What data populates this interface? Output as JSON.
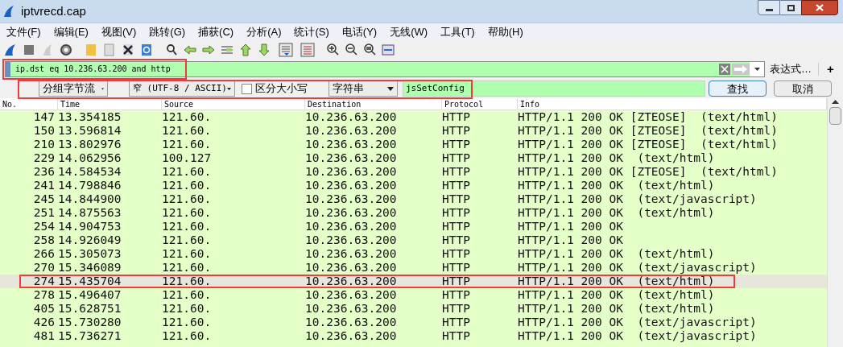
{
  "window": {
    "title": "iptvrecd.cap"
  },
  "menu": [
    "文件(F)",
    "编辑(E)",
    "视图(V)",
    "跳转(G)",
    "捕获(C)",
    "分析(A)",
    "统计(S)",
    "电话(Y)",
    "无线(W)",
    "工具(T)",
    "帮助(H)"
  ],
  "filter": {
    "value": "ip.dst eq 10.236.63.200 and http",
    "expression_label": "表达式…",
    "add_label": "+"
  },
  "find_bar": {
    "search_in": "分组字节流",
    "charset": "窄 (UTF-8 / ASCII)",
    "case_sensitive": {
      "label": "区分大小写",
      "checked": false
    },
    "search_type": "字符串",
    "value": "jsSetConfig",
    "find_button": "查找",
    "cancel_button": "取消"
  },
  "table": {
    "columns": [
      "No.",
      "Time",
      "Source",
      "Destination",
      "Protocol",
      "Info"
    ],
    "rows": [
      {
        "no": "147",
        "time": "13.354185",
        "source": "121.60.",
        "destination": "10.236.63.200",
        "protocol": "HTTP",
        "info": "HTTP/1.1 200 OK [ZTEOSE]  (text/html)",
        "selected": false
      },
      {
        "no": "150",
        "time": "13.596814",
        "source": "121.60.",
        "destination": "10.236.63.200",
        "protocol": "HTTP",
        "info": "HTTP/1.1 200 OK [ZTEOSE]  (text/html)",
        "selected": false
      },
      {
        "no": "210",
        "time": "13.802976",
        "source": "121.60.",
        "destination": "10.236.63.200",
        "protocol": "HTTP",
        "info": "HTTP/1.1 200 OK [ZTEOSE]  (text/html)",
        "selected": false
      },
      {
        "no": "229",
        "time": "14.062956",
        "source": "100.127",
        "destination": "10.236.63.200",
        "protocol": "HTTP",
        "info": "HTTP/1.1 200 OK  (text/html)",
        "selected": false
      },
      {
        "no": "236",
        "time": "14.584534",
        "source": "121.60.",
        "destination": "10.236.63.200",
        "protocol": "HTTP",
        "info": "HTTP/1.1 200 OK [ZTEOSE]  (text/html)",
        "selected": false
      },
      {
        "no": "241",
        "time": "14.798846",
        "source": "121.60.",
        "destination": "10.236.63.200",
        "protocol": "HTTP",
        "info": "HTTP/1.1 200 OK  (text/html)",
        "selected": false
      },
      {
        "no": "245",
        "time": "14.844900",
        "source": "121.60.",
        "destination": "10.236.63.200",
        "protocol": "HTTP",
        "info": "HTTP/1.1 200 OK  (text/javascript)",
        "selected": false
      },
      {
        "no": "251",
        "time": "14.875563",
        "source": "121.60.",
        "destination": "10.236.63.200",
        "protocol": "HTTP",
        "info": "HTTP/1.1 200 OK  (text/html)",
        "selected": false
      },
      {
        "no": "254",
        "time": "14.904753",
        "source": "121.60.",
        "destination": "10.236.63.200",
        "protocol": "HTTP",
        "info": "HTTP/1.1 200 OK",
        "selected": false
      },
      {
        "no": "258",
        "time": "14.926049",
        "source": "121.60.",
        "destination": "10.236.63.200",
        "protocol": "HTTP",
        "info": "HTTP/1.1 200 OK",
        "selected": false
      },
      {
        "no": "266",
        "time": "15.305073",
        "source": "121.60.",
        "destination": "10.236.63.200",
        "protocol": "HTTP",
        "info": "HTTP/1.1 200 OK  (text/html)",
        "selected": false
      },
      {
        "no": "270",
        "time": "15.346089",
        "source": "121.60.",
        "destination": "10.236.63.200",
        "protocol": "HTTP",
        "info": "HTTP/1.1 200 OK  (text/javascript)",
        "selected": false
      },
      {
        "no": "274",
        "time": "15.435704",
        "source": "121.60.",
        "destination": "10.236.63.200",
        "protocol": "HTTP",
        "info": "HTTP/1.1 200 OK  (text/html)",
        "selected": true
      },
      {
        "no": "278",
        "time": "15.496407",
        "source": "121.60.",
        "destination": "10.236.63.200",
        "protocol": "HTTP",
        "info": "HTTP/1.1 200 OK  (text/html)",
        "selected": false
      },
      {
        "no": "405",
        "time": "15.628751",
        "source": "121.60.",
        "destination": "10.236.63.200",
        "protocol": "HTTP",
        "info": "HTTP/1.1 200 OK  (text/html)",
        "selected": false
      },
      {
        "no": "426",
        "time": "15.730280",
        "source": "121.60.",
        "destination": "10.236.63.200",
        "protocol": "HTTP",
        "info": "HTTP/1.1 200 OK  (text/javascript)",
        "selected": false
      },
      {
        "no": "481",
        "time": "15.736271",
        "source": "121.60.",
        "destination": "10.236.63.200",
        "protocol": "HTTP",
        "info": "HTTP/1.1 200 OK  (text/javascript)",
        "selected": false
      }
    ]
  }
}
